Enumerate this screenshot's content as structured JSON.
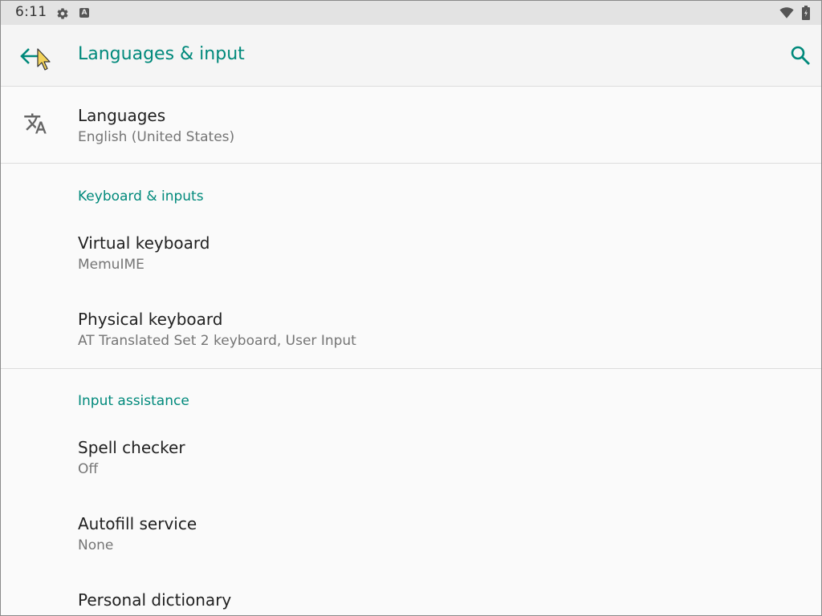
{
  "status_bar": {
    "time": "6:11",
    "settings_icon": "gear-icon",
    "notification_icon": "a-badge-icon",
    "notification_letter": "A",
    "wifi_icon": "wifi-icon",
    "battery_icon": "battery-icon"
  },
  "app_bar": {
    "title": "Languages & input",
    "back_icon": "arrow-back-icon",
    "search_icon": "search-icon"
  },
  "languages": {
    "title": "Languages",
    "summary": "English (United States)",
    "icon": "translate-icon"
  },
  "keyboard_section": {
    "header": "Keyboard & inputs",
    "items": [
      {
        "title": "Virtual keyboard",
        "summary": "MemuIME"
      },
      {
        "title": "Physical keyboard",
        "summary": "AT Translated Set 2 keyboard, User Input"
      }
    ]
  },
  "assistance_section": {
    "header": "Input assistance",
    "items": [
      {
        "title": "Spell checker",
        "summary": "Off"
      },
      {
        "title": "Autofill service",
        "summary": "None"
      },
      {
        "title": "Personal dictionary"
      }
    ]
  },
  "colors": {
    "accent": "#00897b",
    "primary_text": "#212121",
    "secondary_text": "#757575",
    "background": "#fafafa",
    "status_bar": "#e3e3e3"
  }
}
